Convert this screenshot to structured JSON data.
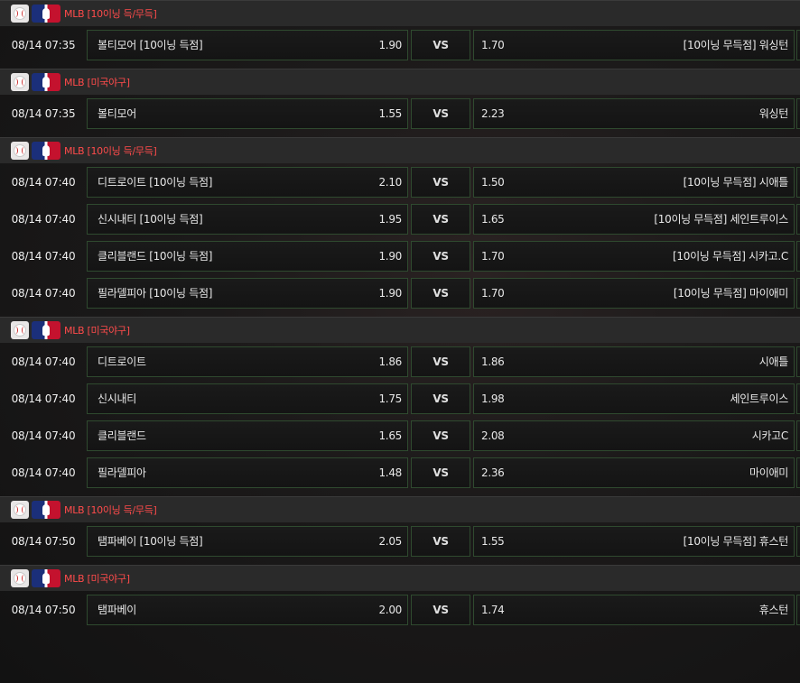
{
  "vs_label": "VS",
  "groups": [
    {
      "league": "MLB [10이닝 득/무득]",
      "matches": [
        {
          "time": "08/14 07:35",
          "home": "볼티모어 [10이닝 득점]",
          "home_odd": "1.90",
          "away_odd": "1.70",
          "away": "[10이닝 무득점] 워싱턴"
        }
      ]
    },
    {
      "league": "MLB [미국야구]",
      "matches": [
        {
          "time": "08/14 07:35",
          "home": "볼티모어",
          "home_odd": "1.55",
          "away_odd": "2.23",
          "away": "워싱턴"
        }
      ]
    },
    {
      "league": "MLB [10이닝 득/무득]",
      "matches": [
        {
          "time": "08/14 07:40",
          "home": "디트로이트 [10이닝 득점]",
          "home_odd": "2.10",
          "away_odd": "1.50",
          "away": "[10이닝 무득점] 시애틀"
        },
        {
          "time": "08/14 07:40",
          "home": "신시내티 [10이닝 득점]",
          "home_odd": "1.95",
          "away_odd": "1.65",
          "away": "[10이닝 무득점] 세인트루이스"
        },
        {
          "time": "08/14 07:40",
          "home": "클리블랜드 [10이닝 득점]",
          "home_odd": "1.90",
          "away_odd": "1.70",
          "away": "[10이닝 무득점] 시카고.C"
        },
        {
          "time": "08/14 07:40",
          "home": "필라델피아 [10이닝 득점]",
          "home_odd": "1.90",
          "away_odd": "1.70",
          "away": "[10이닝 무득점] 마이애미"
        }
      ]
    },
    {
      "league": "MLB [미국야구]",
      "matches": [
        {
          "time": "08/14 07:40",
          "home": "디트로이트",
          "home_odd": "1.86",
          "away_odd": "1.86",
          "away": "시애틀"
        },
        {
          "time": "08/14 07:40",
          "home": "신시내티",
          "home_odd": "1.75",
          "away_odd": "1.98",
          "away": "세인트루이스"
        },
        {
          "time": "08/14 07:40",
          "home": "클리블랜드",
          "home_odd": "1.65",
          "away_odd": "2.08",
          "away": "시카고C"
        },
        {
          "time": "08/14 07:40",
          "home": "필라델피아",
          "home_odd": "1.48",
          "away_odd": "2.36",
          "away": "마이애미"
        }
      ]
    },
    {
      "league": "MLB [10이닝 득/무득]",
      "matches": [
        {
          "time": "08/14 07:50",
          "home": "탬파베이 [10이닝 득점]",
          "home_odd": "2.05",
          "away_odd": "1.55",
          "away": "[10이닝 무득점] 휴스턴"
        }
      ]
    },
    {
      "league": "MLB [미국야구]",
      "matches": [
        {
          "time": "08/14 07:50",
          "home": "탬파베이",
          "home_odd": "2.00",
          "away_odd": "1.74",
          "away": "휴스턴"
        }
      ]
    }
  ]
}
